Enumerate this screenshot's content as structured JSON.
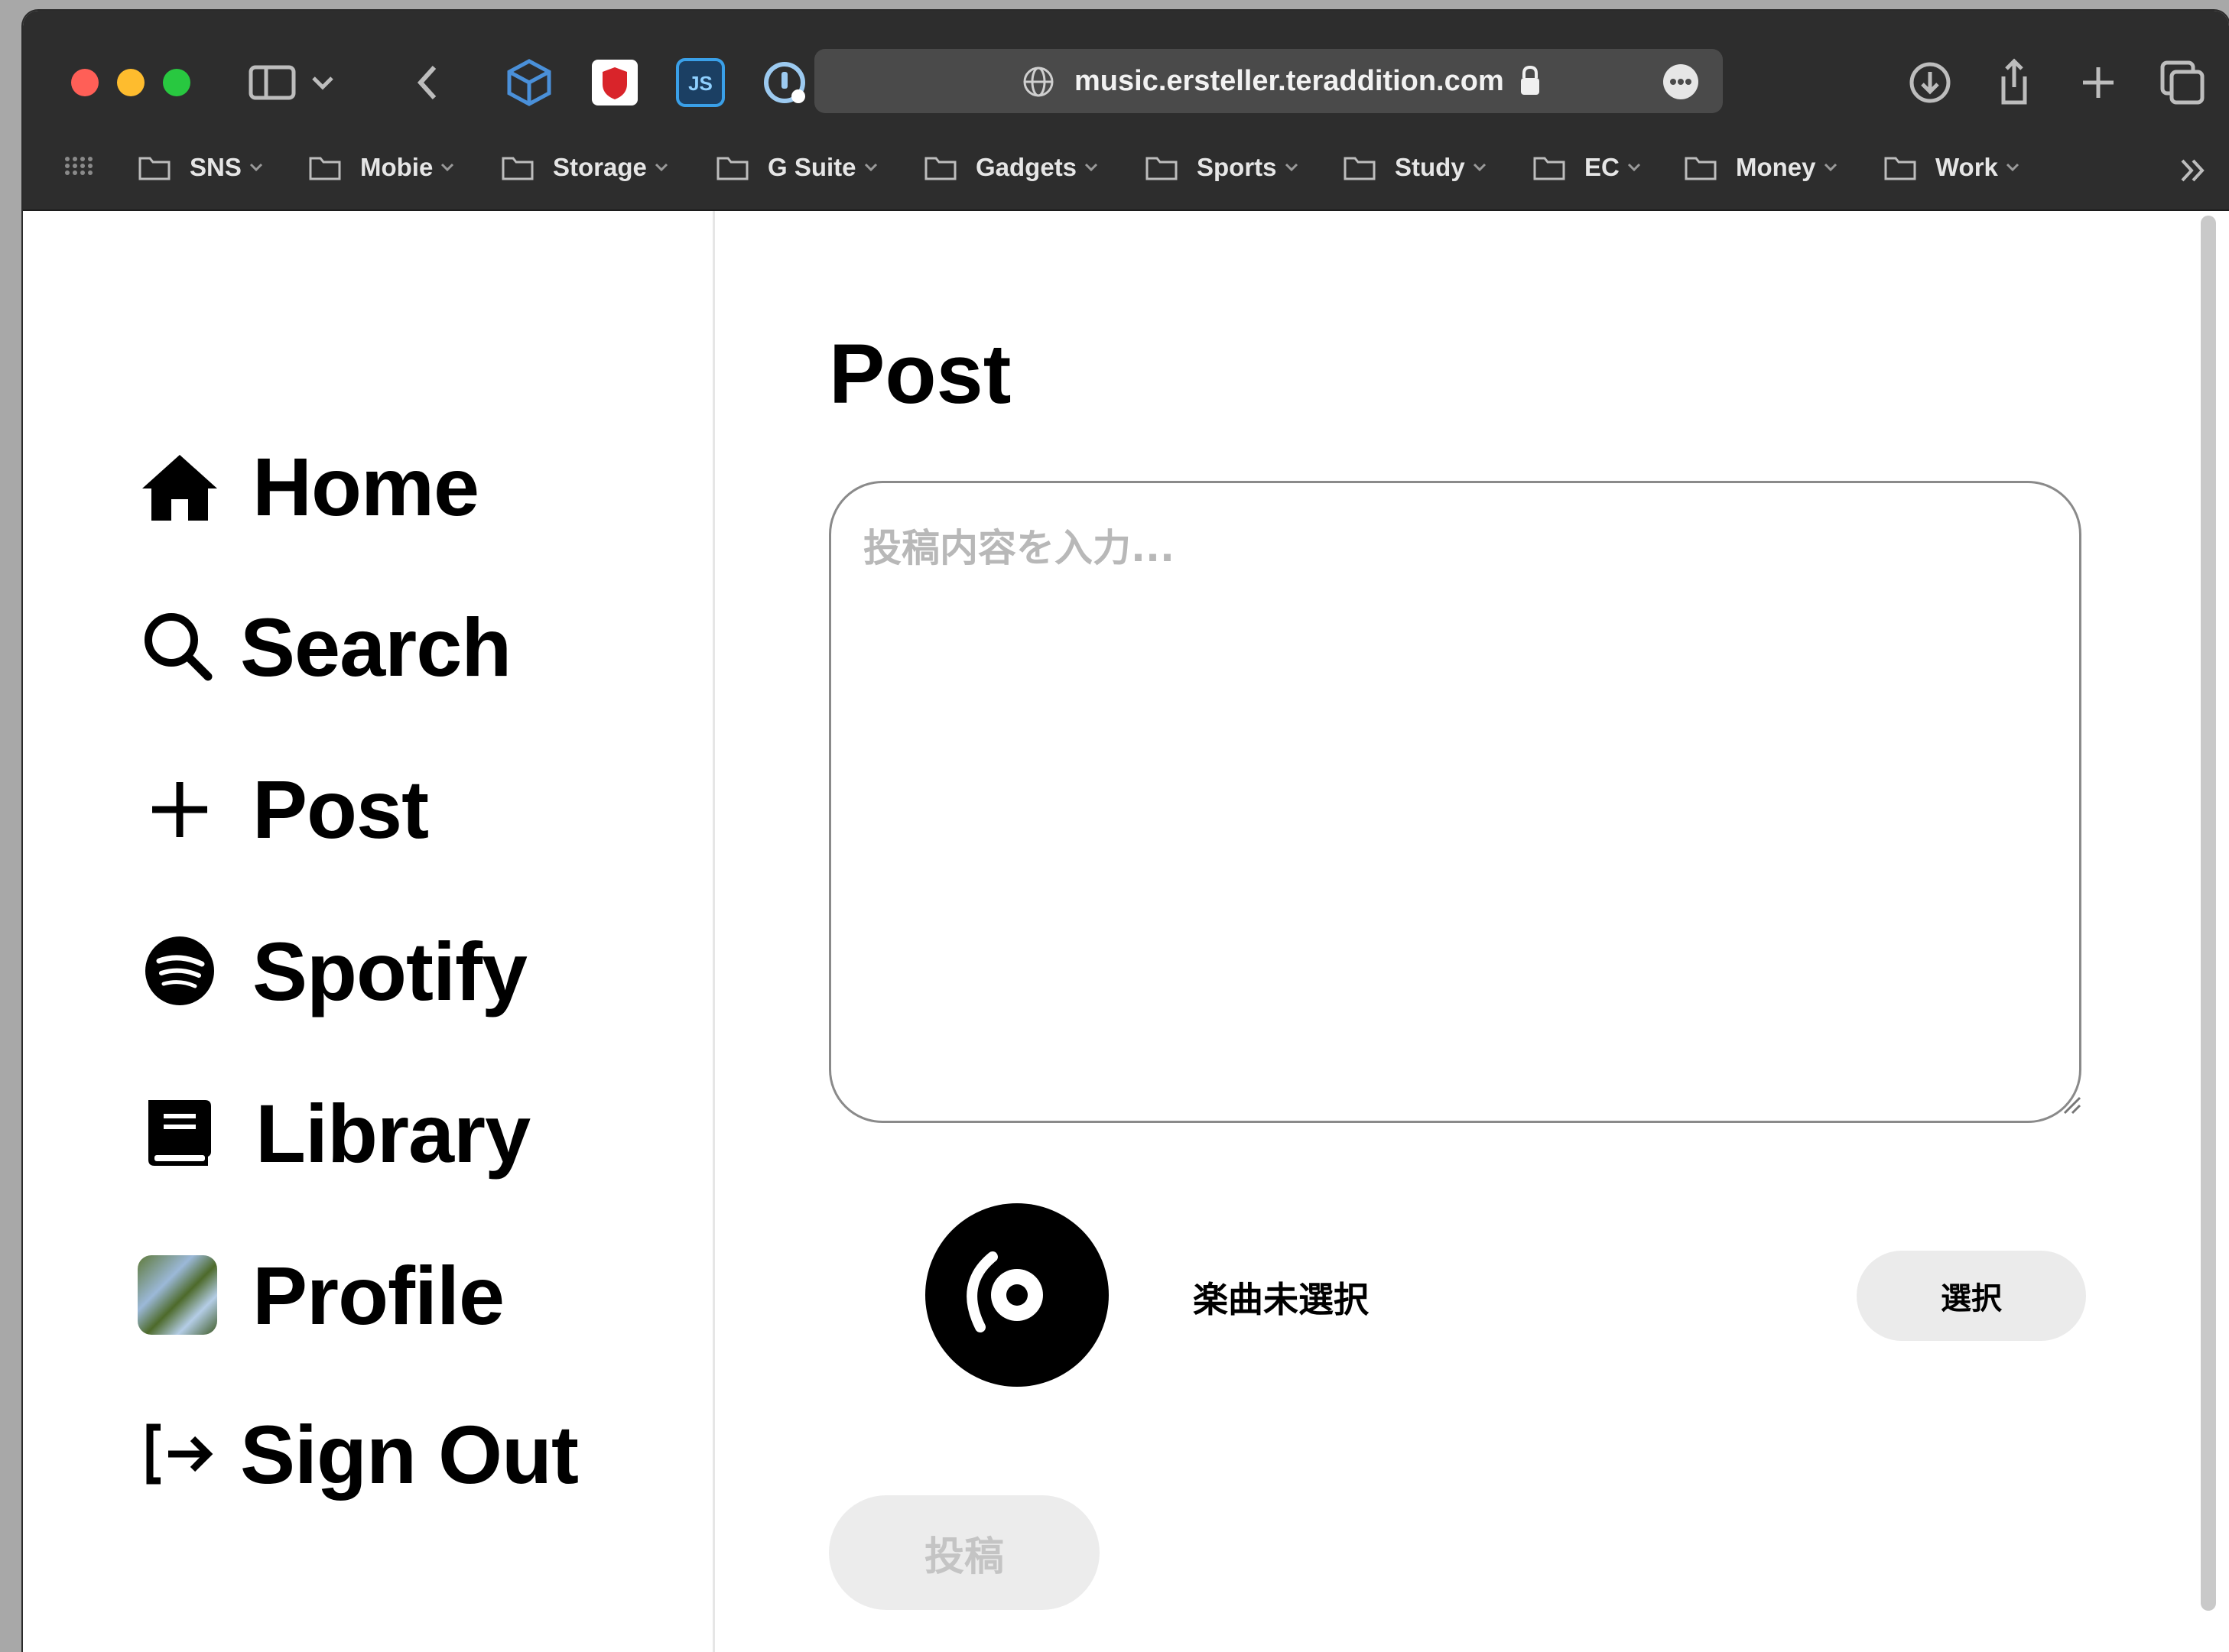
{
  "browser": {
    "url": "music.ersteller.teraddition.com",
    "bookmarks": [
      {
        "label": "SNS"
      },
      {
        "label": "Mobie"
      },
      {
        "label": "Storage"
      },
      {
        "label": "G Suite"
      },
      {
        "label": "Gadgets"
      },
      {
        "label": "Sports"
      },
      {
        "label": "Study"
      },
      {
        "label": "EC"
      },
      {
        "label": "Money"
      },
      {
        "label": "Work"
      }
    ]
  },
  "sidebar": {
    "items": [
      {
        "label": "Home",
        "icon": "home-icon"
      },
      {
        "label": "Search",
        "icon": "search-icon"
      },
      {
        "label": "Post",
        "icon": "plus-icon"
      },
      {
        "label": "Spotify",
        "icon": "spotify-icon"
      },
      {
        "label": "Library",
        "icon": "book-icon"
      },
      {
        "label": "Profile",
        "icon": "avatar"
      },
      {
        "label": "Sign Out",
        "icon": "sign-out-icon"
      }
    ]
  },
  "main": {
    "title": "Post",
    "post_placeholder": "投稿内容を入力...",
    "track_status": "楽曲未選択",
    "select_button": "選択",
    "submit_button": "投稿"
  },
  "colors": {
    "titlebar": "#2d2d2d",
    "close": "#ff5f57",
    "minimize": "#febc2e",
    "maximize": "#28c840",
    "submit_disabled_bg": "#ececec",
    "submit_disabled_text": "#c4c4c4"
  }
}
